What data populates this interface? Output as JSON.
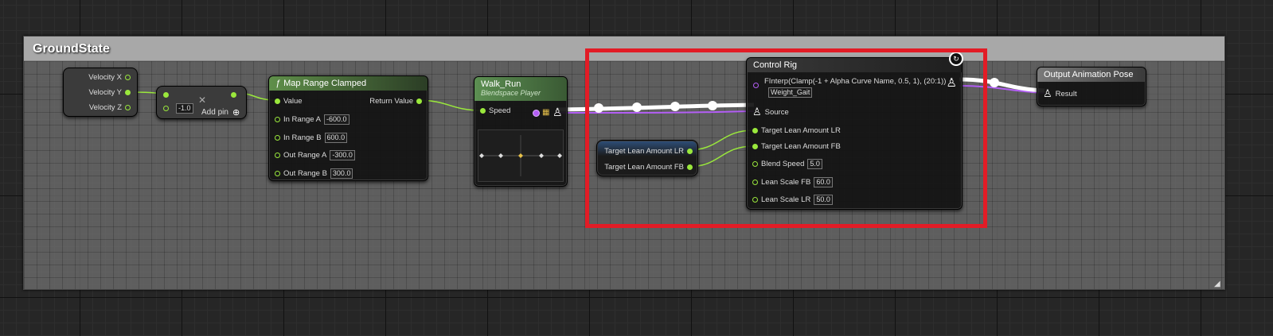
{
  "comment": {
    "title": "GroundState"
  },
  "velocity_node": {
    "pins": [
      "Velocity X",
      "Velocity Y",
      "Velocity Z"
    ]
  },
  "add_node": {
    "value": "-1.0",
    "add_pin_label": "Add pin"
  },
  "map_range": {
    "title": "Map Range Clamped",
    "value_label": "Value",
    "return_label": "Return Value",
    "inputs": [
      {
        "label": "In Range A",
        "value": "-600.0"
      },
      {
        "label": "In Range B",
        "value": "600.0"
      },
      {
        "label": "Out Range A",
        "value": "-300.0"
      },
      {
        "label": "Out Range B",
        "value": "300.0"
      }
    ]
  },
  "blendspace": {
    "title": "Walk_Run",
    "subtitle": "Blendspace Player",
    "speed_label": "Speed"
  },
  "lean_vars": {
    "items": [
      "Target Lean Amount LR",
      "Target Lean Amount FB"
    ]
  },
  "control_rig": {
    "title": "Control Rig",
    "curve_label": "FInterp(Clamp(-1 + Alpha Curve Name, 0.5, 1), (20:1))",
    "curve_value": "Weight_Gait",
    "source_label": "Source",
    "inputs": [
      {
        "label": "Target Lean Amount LR",
        "value": ""
      },
      {
        "label": "Target Lean Amount FB",
        "value": ""
      },
      {
        "label": "Blend Speed",
        "value": "5.0"
      },
      {
        "label": "Lean Scale FB",
        "value": "60.0"
      },
      {
        "label": "Lean Scale LR",
        "value": "50.0"
      }
    ]
  },
  "output_pose": {
    "title": "Output Animation Pose",
    "result_label": "Result"
  },
  "colors": {
    "highlight": "#e21c26",
    "float_pin": "#9ae83c",
    "pose_wire": "#ffffff",
    "bool_pin": "#b35ef5"
  }
}
